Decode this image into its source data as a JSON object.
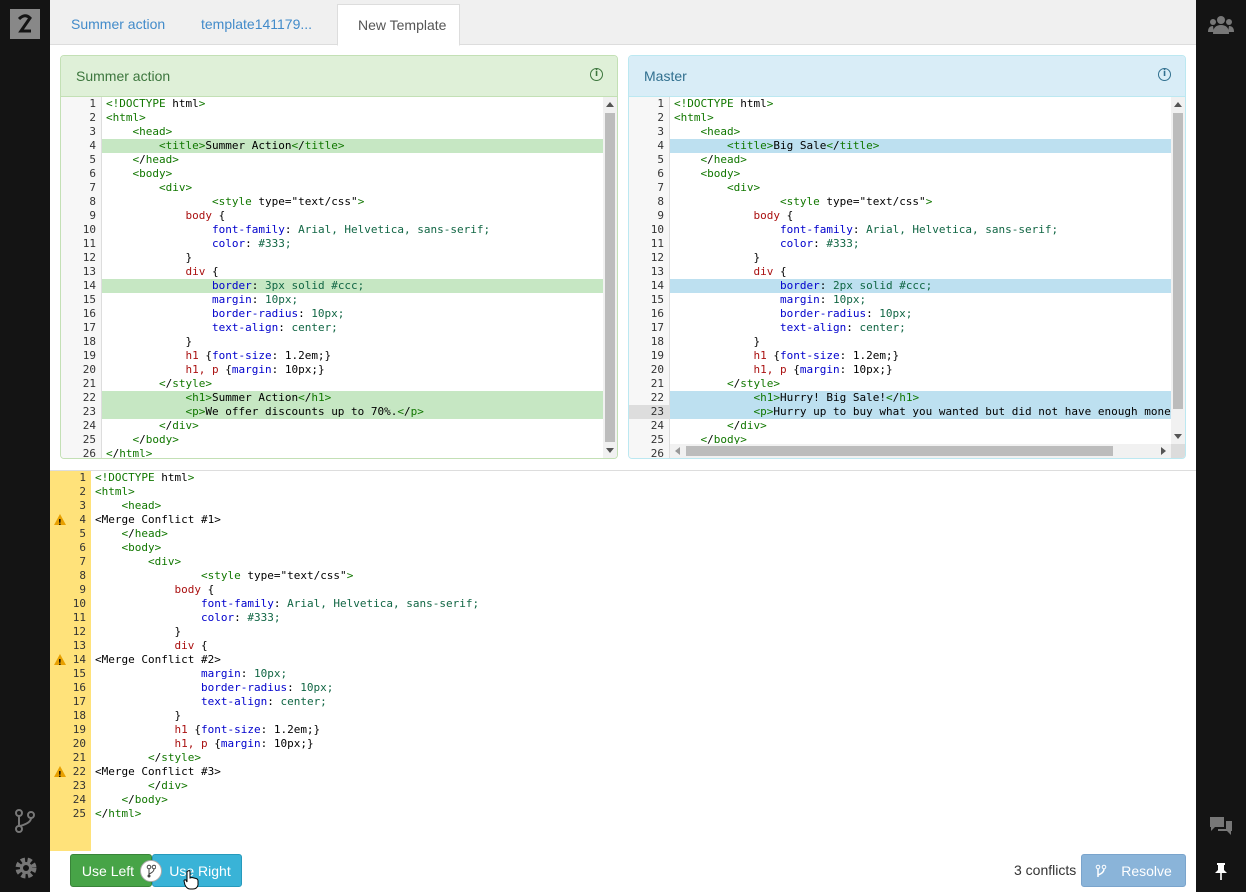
{
  "tabs": [
    "Summer action",
    "template141179...",
    "New Template"
  ],
  "left_panel": {
    "title": "Summer action",
    "color": "#dff0d8",
    "highlight": "#c6e7c3",
    "highlighted_lines": [
      4,
      14,
      22,
      23
    ],
    "lines": [
      "<!DOCTYPE html>",
      "<html>",
      "    <head>",
      "        <title>Summer Action</title>",
      "    </head>",
      "    <body>",
      "        <div>",
      "                <style type=\"text/css\">",
      "            body {",
      "                font-family: Arial, Helvetica, sans-serif;",
      "                color: #333;",
      "            }",
      "            div {",
      "                border: 3px solid #ccc;",
      "                margin: 10px;",
      "                border-radius: 10px;",
      "                text-align: center;",
      "            }",
      "            h1 {font-size: 1.2em;}",
      "            h1, p {margin: 10px;}",
      "        </style>",
      "            <h1>Summer Action</h1>",
      "            <p>We offer discounts up to 70%.</p>",
      "        </div>",
      "    </body>",
      "</html>"
    ]
  },
  "right_panel": {
    "title": "Master",
    "color": "#d9edf7",
    "highlight": "#bde0f0",
    "highlighted_lines": [
      4,
      14,
      22,
      23
    ],
    "active_line": 23,
    "lines": [
      "<!DOCTYPE html>",
      "<html>",
      "    <head>",
      "        <title>Big Sale</title>",
      "    </head>",
      "    <body>",
      "        <div>",
      "                <style type=\"text/css\">",
      "            body {",
      "                font-family: Arial, Helvetica, sans-serif;",
      "                color: #333;",
      "            }",
      "            div {",
      "                border: 2px solid #ccc;",
      "                margin: 10px;",
      "                border-radius: 10px;",
      "                text-align: center;",
      "            }",
      "            h1 {font-size: 1.2em;}",
      "            h1, p {margin: 10px;}",
      "        </style>",
      "            <h1>Hurry! Big Sale!</h1>",
      "            <p>Hurry up to buy what you wanted but did not have enough money</p>",
      "        </div>",
      "    </body>",
      "</html>"
    ]
  },
  "merge": {
    "conflict_lines": [
      4,
      14,
      22
    ],
    "lines": [
      "<!DOCTYPE html>",
      "<html>",
      "    <head>",
      "<Merge Conflict #1>",
      "    </head>",
      "    <body>",
      "        <div>",
      "                <style type=\"text/css\">",
      "            body {",
      "                font-family: Arial, Helvetica, sans-serif;",
      "                color: #333;",
      "            }",
      "            div {",
      "<Merge Conflict #2>",
      "                margin: 10px;",
      "                border-radius: 10px;",
      "                text-align: center;",
      "            }",
      "            h1 {font-size: 1.2em;}",
      "            h1, p {margin: 10px;}",
      "        </style>",
      "<Merge Conflict #3>",
      "        </div>",
      "    </body>",
      "</html>"
    ]
  },
  "footer": {
    "use_left": "Use Left",
    "use_right": "Use Right",
    "conflicts": "3 conflicts",
    "resolve": "Resolve"
  },
  "icons": [
    "logo-icon",
    "users-icon",
    "branch-icon",
    "gear-icon",
    "chat-icon",
    "pin-icon",
    "info-icon",
    "warning-icon",
    "merge-icon",
    "hand-cursor-icon"
  ]
}
